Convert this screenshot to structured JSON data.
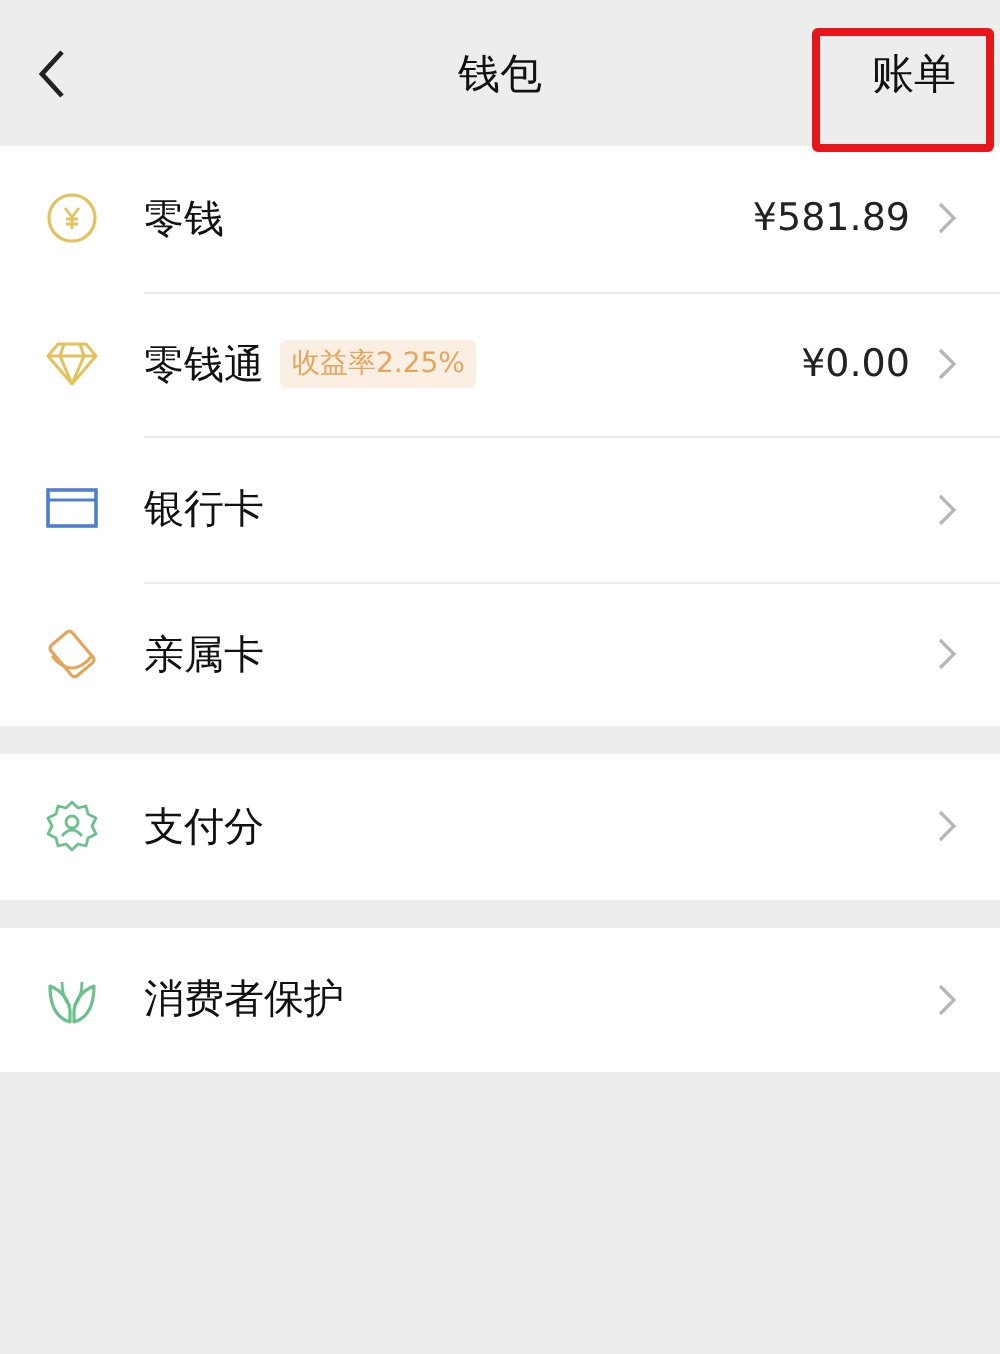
{
  "header": {
    "title": "钱包",
    "bill_button": {
      "label": "账单",
      "highlighted": true
    }
  },
  "groups": [
    {
      "items": [
        {
          "label": "零钱",
          "value": "¥581.89"
        },
        {
          "label": "零钱通",
          "badge": "收益率2.25%",
          "value": "¥0.00"
        },
        {
          "label": "银行卡"
        },
        {
          "label": "亲属卡"
        }
      ]
    },
    {
      "items": [
        {
          "label": "支付分"
        }
      ]
    },
    {
      "items": [
        {
          "label": "消费者保护"
        }
      ]
    }
  ]
}
